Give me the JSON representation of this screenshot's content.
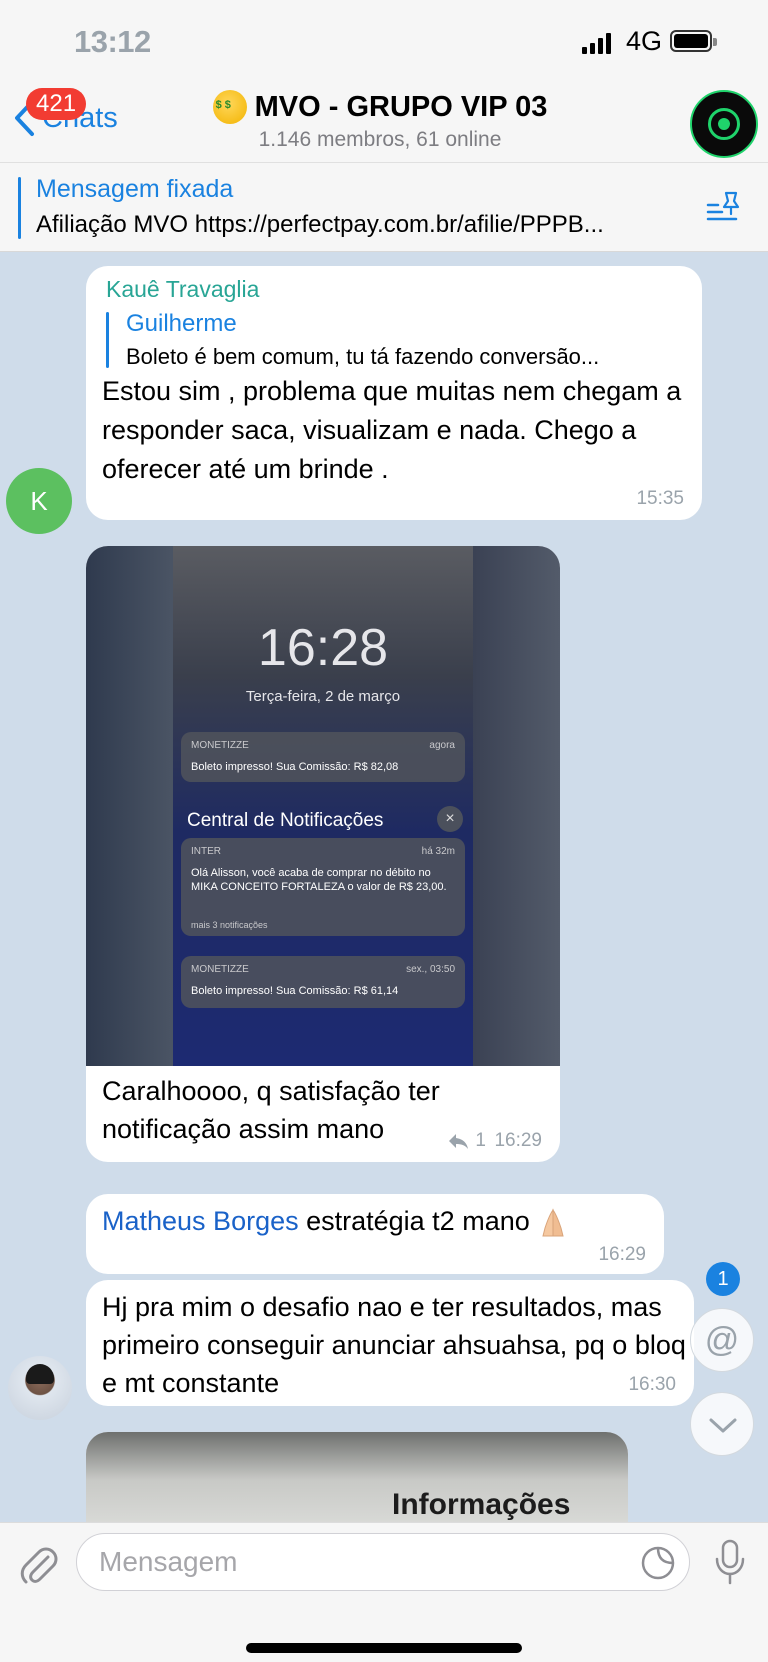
{
  "status": {
    "time": "13:12",
    "network": "4G"
  },
  "header": {
    "back_label": "Chats",
    "unread_badge": "421",
    "title": "MVO - GRUPO VIP 03",
    "subtitle": "1.146 membros, 61 online"
  },
  "pinned": {
    "title": "Mensagem fixada",
    "text": "Afiliação MVO https://perfectpay.com.br/afilie/PPPB..."
  },
  "messages": [
    {
      "sender": "Kauê Travaglia",
      "reply_to_name": "Guilherme",
      "reply_to_text": "Boleto é bem comum, tu tá fazendo conversão...",
      "text": "Estou sim , problema que muitas nem chegam a responder saca, visualizam e nada. Chego a oferecer até um brinde .",
      "time": "15:35",
      "avatar_letter": "K"
    },
    {
      "image": {
        "time": "16:28",
        "date": "Terça-feira, 2 de março",
        "notifications": [
          {
            "app": "MONETIZZE",
            "when": "agora",
            "text": "Boleto impresso! Sua Comissão: R$ 82,08"
          },
          {
            "app": "INTER",
            "when": "há 32m",
            "text": "Olá Alisson, você acaba de comprar no débito no MIKA CONCEITO FORTALEZA o valor de R$ 23,00.",
            "more": "mais 3 notificações"
          },
          {
            "app": "MONETIZZE",
            "when": "sex., 03:50",
            "text": "Boleto impresso! Sua Comissão: R$ 61,14"
          }
        ],
        "center_title": "Central de Notificações"
      },
      "text": "Caralhoooo, q satisfação ter notificação assim mano",
      "reply_count": "1",
      "time": "16:29"
    },
    {
      "mention": "Matheus Borges",
      "text": " estratégia t2 mano",
      "time": "16:29"
    },
    {
      "text": "Hj pra mim o desafio nao e ter resultados, mas primeiro conseguir anunciar ahsuahsa, pq o bloq e mt constante",
      "time": "16:30"
    },
    {
      "image_text": "Informações"
    }
  ],
  "mention_badge": "1",
  "input": {
    "placeholder": "Mensagem"
  },
  "colors": {
    "accent": "#1a82e0",
    "sender": "#28a595",
    "badge": "#f23c32",
    "chat_bg": "#cfdcea"
  }
}
